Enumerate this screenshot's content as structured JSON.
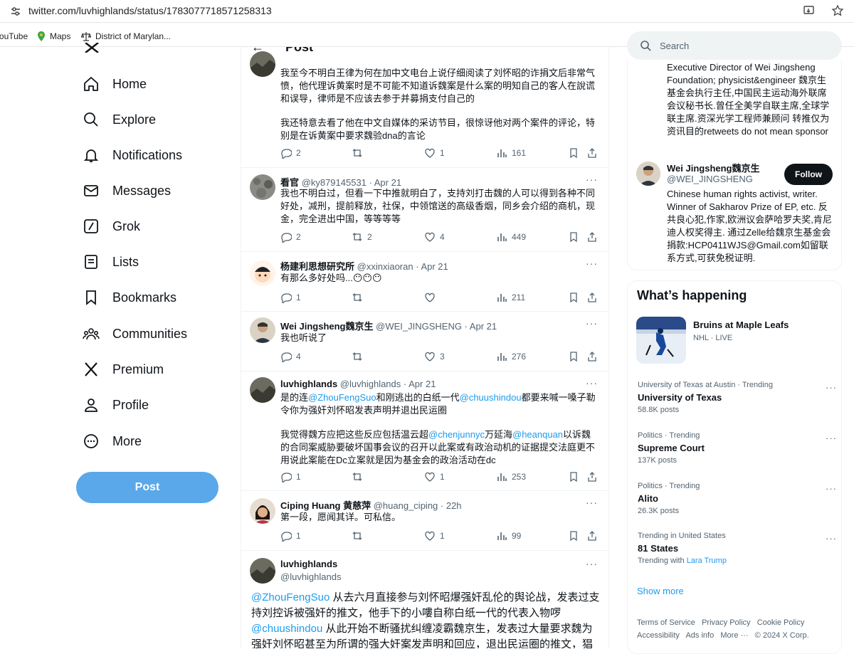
{
  "browser": {
    "url": "twitter.com/luvhighlands/status/1783077718571258313",
    "bookmarks": [
      "YouTube",
      "Maps",
      "District of Marylan..."
    ]
  },
  "header": {
    "title": "Post",
    "search_placeholder": "Search"
  },
  "nav": [
    {
      "label": "Home",
      "icon": "home-icon"
    },
    {
      "label": "Explore",
      "icon": "search-icon"
    },
    {
      "label": "Notifications",
      "icon": "bell-icon"
    },
    {
      "label": "Messages",
      "icon": "mail-icon"
    },
    {
      "label": "Grok",
      "icon": "grok-icon"
    },
    {
      "label": "Lists",
      "icon": "list-icon"
    },
    {
      "label": "Bookmarks",
      "icon": "bookmark-icon"
    },
    {
      "label": "Communities",
      "icon": "communities-icon"
    },
    {
      "label": "Premium",
      "icon": "x-logo-icon"
    },
    {
      "label": "Profile",
      "icon": "person-icon"
    },
    {
      "label": "More",
      "icon": "more-circle-icon"
    }
  ],
  "post_button": "Post",
  "tweets": [
    {
      "name": "",
      "handle": "",
      "time": "",
      "text": "我至今不明白王律为何在加中文电台上说仔细阅读了刘怀昭的诈捐文后非常气愤，他代理诉黄案时是不可能不知道诉魏案是什么案的明知自己的客人在說谎和误导，律师是不应该去参于并募捐支付自己的",
      "text2": "我还特意去看了他在中文自媒体的采访节目，很惊讶他对两个案件的评论，特别是在诉黄案中要求魏验dna的言论",
      "replies": "2",
      "reposts": "",
      "likes": "1",
      "views": "161"
    },
    {
      "name": "看官",
      "handle": "@ky879145531",
      "time": "Apr 21",
      "text": "我也不明白过，但看一下中推就明白了，支持刘打击魏的人可以得到各种不同好处，减刑，提前释放，社保，中领馆送的高级香烟，同乡会介绍的商机，现金，完全进出中国，等等等等",
      "replies": "2",
      "reposts": "2",
      "likes": "4",
      "views": "449"
    },
    {
      "name": "杨建利思想研究所",
      "handle": "@xxinxiaoran",
      "time": "Apr 21",
      "text": "有那么多好处吗...😶😶😶",
      "replies": "1",
      "reposts": "",
      "likes": "",
      "views": "211"
    },
    {
      "name": "Wei Jingsheng魏京生",
      "handle": "@WEI_JINGSHENG",
      "time": "Apr 21",
      "text": "我也听说了",
      "replies": "4",
      "reposts": "",
      "likes": "3",
      "views": "276"
    },
    {
      "name": "luvhighlands",
      "handle": "@luvhighlands",
      "time": "Apr 21",
      "t_a": "是的连",
      "m1": "@ZhouFengSuo",
      "t_b": "和刚逃出的白纸一代",
      "m2": "@chuushindou",
      "t_c": "都要来喊一嗓子勒令你为强奸刘怀昭发表声明并退出民运圈",
      "p2_a": "我觉得魏方应把这些反应包括温云超",
      "m3": "@chenjunnyc",
      "p2_b": "万延海",
      "m4": "@heanquan",
      "p2_c": "以诉魏的合同案威胁要破坏国事会议的召开以此案或有政治动机的证据提交法庭更不用说此案能在Dc立案就是因为基金会的政治活动在dc",
      "replies": "1",
      "reposts": "",
      "likes": "1",
      "views": "253"
    },
    {
      "name": "Ciping Huang 黄慈萍",
      "handle": "@huang_ciping",
      "time": "22h",
      "text": "第一段，愿闻其详。可私信。",
      "replies": "1",
      "reposts": "",
      "likes": "1",
      "views": "99"
    }
  ],
  "main_tweet": {
    "name": "luvhighlands",
    "handle": "@luvhighlands",
    "m1": "@ZhouFengSuo",
    "t1": " 从去六月直接参与刘怀昭爆强奸乱伦的舆论战，发表过支持刘控诉被强奸的推文，他手下的小嘍自称白纸一代的代表入物啰",
    "m2": "@chuushindou",
    "t2": " 从此开始不断骚扰纠缠凌霸魏京生，发表过大量要求魏为强奸刘怀昭甚至为所谓的强大奸案发声明和回应，退出民运圈的推文，猖狂甚"
  },
  "right": {
    "bio1": "Executive Director of Wei Jingsheng Foundation; physicist&engineer 魏京生基金会执行主任,中国民主运动海外联席会议秘书长.曾任全美学自联主席,全球学联主席.资深光学工程师兼顾问 转推仅为资讯目的retweets do not mean sponsor",
    "user": {
      "name": "Wei Jingsheng魏京生",
      "handle": "@WEI_JINGSHENG",
      "follow": "Follow",
      "bio": "Chinese human rights activist, writer. Winner of Sakharov Prize of EP, etc. 反共良心犯,作家,欧洲议会萨哈罗夫奖,肯尼迪人权奖得主. 通过Zelle给魏京生基金会捐款:HCP0411WJS@Gmail.com如留联系方式,可获免税证明."
    },
    "happening": {
      "title": "What’s happening",
      "event": "Bruins at Maple Leafs",
      "event_meta": "NHL · LIVE",
      "trends": [
        {
          "cat": "University of Texas at Austin · Trending",
          "title": "University of Texas",
          "posts": "58.8K posts"
        },
        {
          "cat": "Politics · Trending",
          "title": "Supreme Court",
          "posts": "137K posts"
        },
        {
          "cat": "Politics · Trending",
          "title": "Alito",
          "posts": "26.3K posts"
        },
        {
          "cat": "Trending in United States",
          "title": "81 States",
          "posts": "Trending with",
          "with": "Lara Trump"
        }
      ],
      "show_more": "Show more"
    },
    "footer": [
      "Terms of Service",
      "Privacy Policy",
      "Cookie Policy",
      "Accessibility",
      "Ads info",
      "More ···",
      "© 2024 X Corp."
    ]
  }
}
